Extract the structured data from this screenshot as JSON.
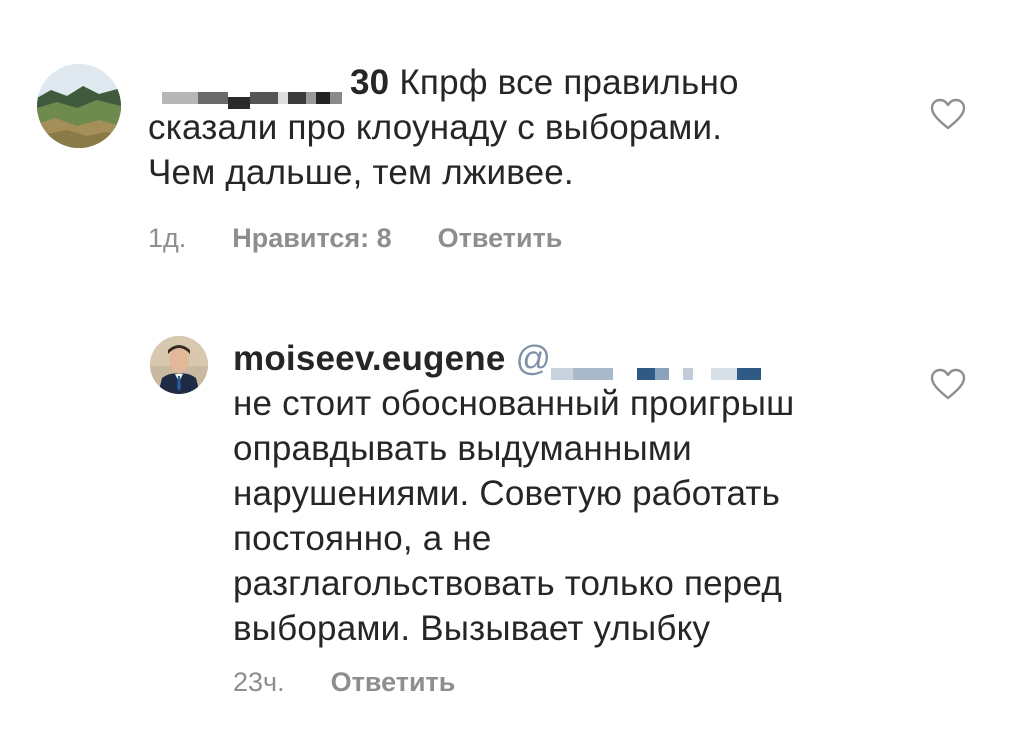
{
  "comments": [
    {
      "username": "",
      "username_suffix": "30",
      "text_line1": "Кпрф все правильно",
      "text_line2": "сказали про клоунаду с выборами.",
      "text_line3": "Чем дальше, тем лживее.",
      "time": "1д.",
      "likes": "Нравится: 8",
      "reply": "Ответить",
      "avatar_icon": "landscape-avatar"
    },
    {
      "username": "moiseev.eugene",
      "mention_prefix": "@",
      "text_lines": [
        "не стоит обоснованный проигрыш",
        "оправдывать выдуманными",
        "нарушениями. Советую работать",
        "постоянно, а не",
        "разглагольствовать только перед",
        "выборами. Вызывает улыбку"
      ],
      "time": "23ч.",
      "reply": "Ответить",
      "avatar_icon": "man-portrait-avatar"
    }
  ],
  "icons": {
    "like": "heart-outline-icon"
  },
  "colors": {
    "text": "#262626",
    "secondary": "#8e8e8e"
  }
}
